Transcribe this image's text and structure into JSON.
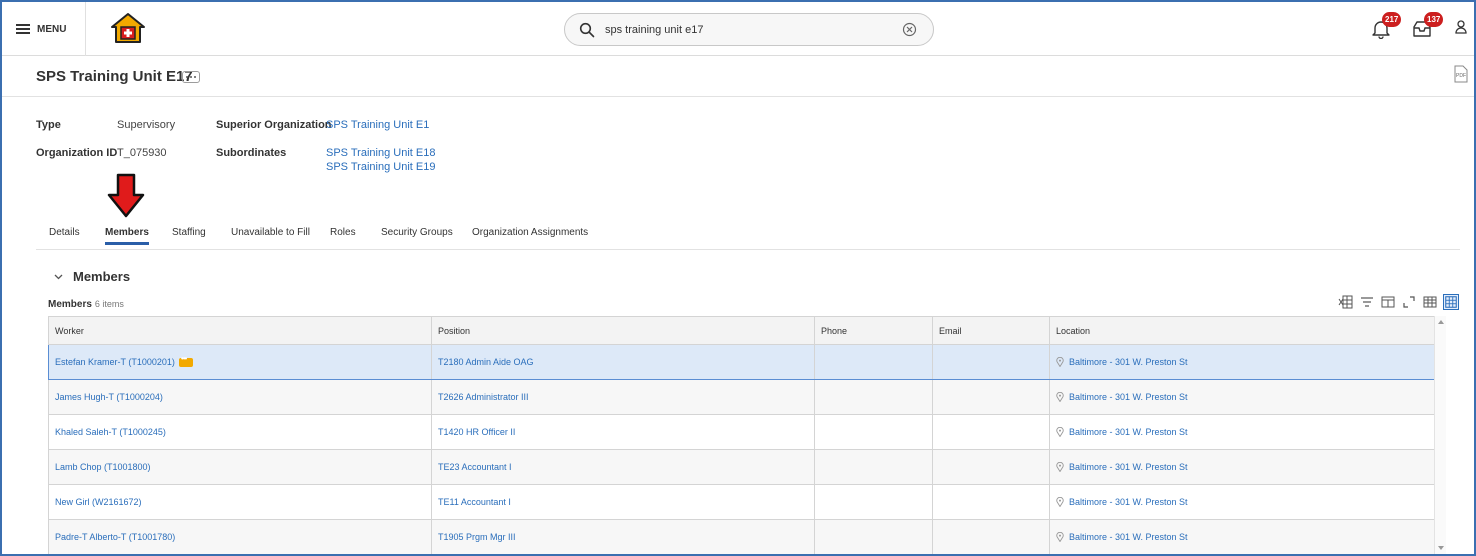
{
  "topbar": {
    "menu_label": "MENU",
    "search_value": "sps training unit e17",
    "notifications_count": "217",
    "inbox_count": "137"
  },
  "header": {
    "title": "SPS Training Unit E17",
    "pdf_label": "PDF"
  },
  "info": {
    "type_label": "Type",
    "type_value": "Supervisory",
    "org_id_label": "Organization ID",
    "org_id_value": "T_075930",
    "superior_label": "Superior Organization",
    "superior_value": "SPS Training Unit E1",
    "subordinates_label": "Subordinates",
    "subordinates": [
      "SPS Training Unit E18",
      "SPS Training Unit E19"
    ]
  },
  "tabs": [
    {
      "label": "Details"
    },
    {
      "label": "Members"
    },
    {
      "label": "Staffing"
    },
    {
      "label": "Unavailable to Fill"
    },
    {
      "label": "Roles"
    },
    {
      "label": "Security Groups"
    },
    {
      "label": "Organization Assignments"
    }
  ],
  "section": {
    "title": "Members",
    "grid_caption": "Members",
    "grid_count": "6 items"
  },
  "table": {
    "columns": [
      "Worker",
      "Position",
      "Phone",
      "Email",
      "Location"
    ],
    "rows": [
      {
        "worker": "Estefan Kramer-T (T1000201)",
        "position": "T2180 Admin Aide OAG",
        "phone": "",
        "email": "",
        "location": "Baltimore - 301 W. Preston St"
      },
      {
        "worker": "James Hugh-T (T1000204)",
        "position": "T2626 Administrator III",
        "phone": "",
        "email": "",
        "location": "Baltimore - 301 W. Preston St"
      },
      {
        "worker": "Khaled Saleh-T (T1000245)",
        "position": "T1420 HR Officer II",
        "phone": "",
        "email": "",
        "location": "Baltimore - 301 W. Preston St"
      },
      {
        "worker": "Lamb Chop (T1001800)",
        "position": "TE23 Accountant I",
        "phone": "",
        "email": "",
        "location": "Baltimore - 301 W. Preston St"
      },
      {
        "worker": "New Girl (W2161672)",
        "position": "TE11 Accountant I",
        "phone": "",
        "email": "",
        "location": "Baltimore - 301 W. Preston St"
      },
      {
        "worker": "Padre-T Alberto-T (T1001780)",
        "position": "T1905 Prgm Mgr III",
        "phone": "",
        "email": "",
        "location": "Baltimore - 301 W. Preston St"
      }
    ]
  },
  "colors": {
    "link": "#2a6ebb",
    "badge": "#cc1f1f",
    "arrow": "#e01b1b",
    "selected_row": "#dde9f8"
  }
}
